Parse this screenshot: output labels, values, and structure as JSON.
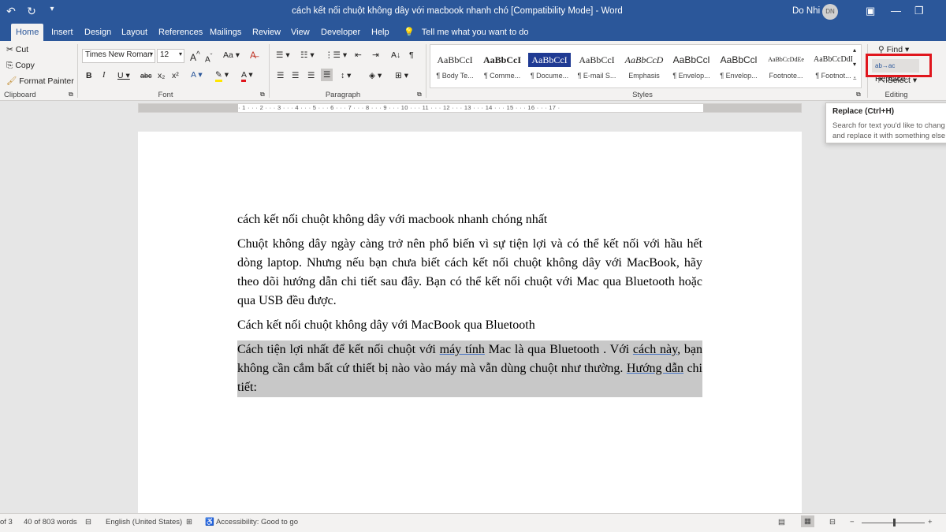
{
  "titlebar": {
    "title": "cách kết nối chuột không dây với macbook nhanh chó [Compatibility Mode] - Word",
    "user": "Do Nhi",
    "initials": "DN"
  },
  "tabs": [
    "Home",
    "Insert",
    "Design",
    "Layout",
    "References",
    "Mailings",
    "Review",
    "View",
    "Developer",
    "Help"
  ],
  "tell_me": "Tell me what you want to do",
  "clipboard": {
    "cut": "Cut",
    "copy": "Copy",
    "format_painter": "Format Painter",
    "label": "Clipboard"
  },
  "font": {
    "name": "Times New Roman",
    "size": "12",
    "label": "Font"
  },
  "paragraph": {
    "label": "Paragraph"
  },
  "styles": {
    "label": "Styles",
    "items": [
      {
        "preview": "AaBbCcI",
        "name": "¶ Body Te..."
      },
      {
        "preview": "AaBbCcI",
        "name": "¶ Comme..."
      },
      {
        "preview": "AaBbCcI",
        "name": "¶ Docume..."
      },
      {
        "preview": "AaBbCcI",
        "name": "¶ E-mail S..."
      },
      {
        "preview": "AaBbCcD",
        "name": "Emphasis"
      },
      {
        "preview": "AaBbCcl",
        "name": "¶ Envelop..."
      },
      {
        "preview": "AaBbCcl",
        "name": "¶ Envelop..."
      },
      {
        "preview": "AaBbCcDdEe",
        "name": "Footnote..."
      },
      {
        "preview": "AaBbCcDdI",
        "name": "¶ Footnot..."
      }
    ]
  },
  "editing": {
    "find": "Find",
    "replace": "Replace",
    "select": "Select",
    "label": "Editing"
  },
  "tooltip": {
    "title": "Replace (Ctrl+H)",
    "line1": "Search for text you'd like to chang",
    "line2": "and replace it with something else"
  },
  "ruler": {
    "ticks": "· 1 · · · 2 · · · 3 · · · 4 · · · 5 · · · 6 · · · 7 · · · 8 · · · 9 · · · 10 · · · 11 · · · 12 · · · 13 · · · 14 · · · 15 · · · 16 · · · 17 ·"
  },
  "document": {
    "title": "cách kết nối chuột không dây với macbook nhanh chóng nhất",
    "intro": "Chuột không dây ngày càng trở nên phổ biến vì sự tiện lợi và có thể kết nối với hầu hết dòng laptop. Nhưng nếu bạn chưa biết cách kết nối chuột không dây với MacBook, hãy theo dõi hướng dẫn chi tiết sau đây. Bạn có thể kết nối chuột với Mac qua Bluetooth hoặc qua USB đều được.",
    "heading": "Cách kết nối chuột không dây với MacBook qua Bluetooth",
    "sel_1": "Cách tiện lợi nhất để kết nối chuột với ",
    "sel_link1": "máy tính",
    "sel_2": " Mac là qua Bluetooth . Với ",
    "sel_link2": "cách này",
    "sel_3": ", bạn không cần cắm bất cứ thiết bị nào vào máy mà vẫn dùng chuột như thường. ",
    "sel_link3": "Hướng dẫn",
    "sel_4": " chi tiết:"
  },
  "status": {
    "page": "of 3",
    "words": "40 of 803 words",
    "language": "English (United States)",
    "accessibility": "Accessibility: Good to go"
  },
  "colors": {
    "brand": "#2b579a",
    "highlight": "#e0161d"
  }
}
